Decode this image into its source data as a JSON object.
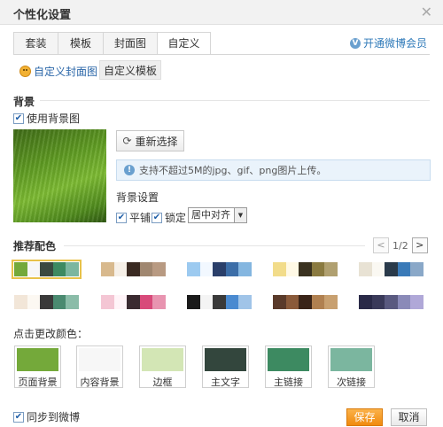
{
  "window": {
    "title": "个性化设置"
  },
  "tabs": [
    {
      "label": "套装"
    },
    {
      "label": "模板"
    },
    {
      "label": "封面图"
    },
    {
      "label": "自定义"
    }
  ],
  "vip_link": "开通微博会员",
  "subtabs": {
    "cover": "自定义封面图",
    "template": "自定义模板"
  },
  "background": {
    "title": "背景",
    "use_bg_label": "使用背景图",
    "reselect_label": "重新选择",
    "tip": "支持不超过5M的jpg、gif、png图片上传。",
    "settings_title": "背景设置",
    "tile_label": "平铺",
    "lock_label": "锁定",
    "align_value": "居中对齐"
  },
  "recommend": {
    "title": "推荐配色",
    "pager": "1/2",
    "palettes": [
      {
        "colors": [
          "#74a93a",
          "#f7f7f7",
          "#3a4a40",
          "#3d8a61",
          "#7bb69f"
        ]
      },
      {
        "colors": [
          "#d8b98d",
          "#f6f0e8",
          "#3a2a22",
          "#a08770",
          "#b89a82"
        ]
      },
      {
        "colors": [
          "#9ccaf0",
          "#f2f8ff",
          "#2a3f6a",
          "#3c6ea8",
          "#84b6e0"
        ]
      },
      {
        "colors": [
          "#f2dc8a",
          "#fff9e6",
          "#3a3220",
          "#8a7a40",
          "#b0a070"
        ]
      },
      {
        "colors": [
          "#e8e2d4",
          "#faf8f2",
          "#2a3a4a",
          "#3a7ab8",
          "#8aa8c8"
        ]
      },
      {
        "colors": [
          "#f2e6d8",
          "#fcf8f2",
          "#3a3a3a",
          "#4a8a70",
          "#8abca8"
        ]
      },
      {
        "colors": [
          "#f4c6d4",
          "#fff4f8",
          "#3a2a30",
          "#d84a7a",
          "#e894b0"
        ]
      },
      {
        "colors": [
          "#1a1a1a",
          "#f4f4f4",
          "#3a3a3a",
          "#4a8ad0",
          "#a0c4e8"
        ]
      },
      {
        "colors": [
          "#5a3a2a",
          "#8a5a3a",
          "#3a2418",
          "#b08050",
          "#c8a070"
        ]
      },
      {
        "colors": [
          "#2a2a48",
          "#3a3a5a",
          "#5a5a80",
          "#8a8ab8",
          "#b0a8d8"
        ]
      }
    ]
  },
  "colors": {
    "title": "点击更改颜色：",
    "items": [
      {
        "label": "页面背景",
        "color": "#74a93a"
      },
      {
        "label": "内容背景",
        "color": "#f7f7f7"
      },
      {
        "label": "边框",
        "color": "#d3e6b5"
      },
      {
        "label": "主文字",
        "color": "#33463d"
      },
      {
        "label": "主链接",
        "color": "#3d8a61"
      },
      {
        "label": "次链接",
        "color": "#7bb69f"
      }
    ]
  },
  "footer": {
    "sync_label": "同步到微博",
    "save_label": "保存",
    "cancel_label": "取消"
  }
}
